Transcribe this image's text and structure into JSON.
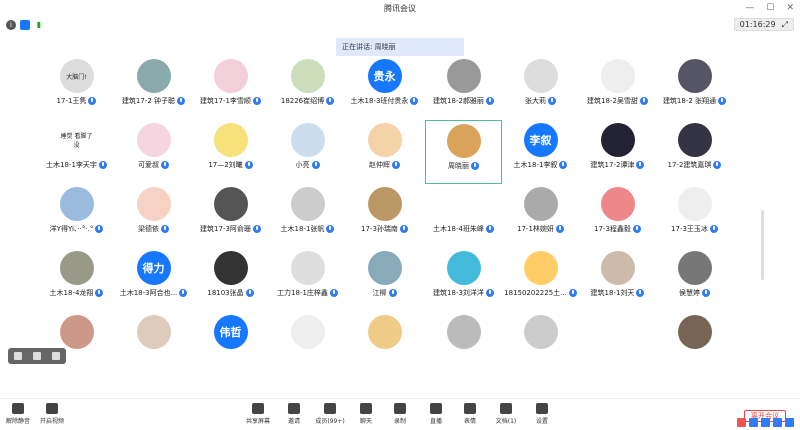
{
  "window": {
    "title": "腾讯会议",
    "timer": "01:16:29"
  },
  "speaking": "正在讲话: 周晓丽",
  "participants": [
    {
      "name": "17-1王隽",
      "avatar": "img",
      "color": "#ddd",
      "label": "大脑门!"
    },
    {
      "name": "建筑17-2 钟子聪",
      "avatar": "img",
      "color": "#8aa"
    },
    {
      "name": "建筑17-1李雪顺",
      "avatar": "img",
      "color": "#f3cfd9"
    },
    {
      "name": "18226崔绍博",
      "avatar": "img",
      "color": "#cdb"
    },
    {
      "name": "土木18-3班付贵永",
      "avatar": "text",
      "text": "贵永"
    },
    {
      "name": "建筑18-2郝雅丽",
      "avatar": "img",
      "color": "#999"
    },
    {
      "name": "张大莉",
      "avatar": "img",
      "color": "#ddd"
    },
    {
      "name": "建筑18-2吴雪甜",
      "avatar": "img",
      "color": "#eee"
    },
    {
      "name": "建筑18-2 张翔通",
      "avatar": "img",
      "color": "#556"
    },
    {
      "name": "土木18-1李天宇",
      "avatar": "img",
      "color": "#fff",
      "label": "睡觉 看脚了没"
    },
    {
      "name": "可爱叔",
      "avatar": "img",
      "color": "#f5d5e0"
    },
    {
      "name": "17—2刘曦",
      "avatar": "img",
      "color": "#f7e27a"
    },
    {
      "name": "小亮",
      "avatar": "img",
      "color": "#cde"
    },
    {
      "name": "赵仲辉",
      "avatar": "img",
      "color": "#f4d3a8"
    },
    {
      "name": "周晓丽",
      "avatar": "img",
      "color": "#d9a35b",
      "active": true
    },
    {
      "name": "土木18-1李叙",
      "avatar": "text",
      "text": "李叙"
    },
    {
      "name": "建筑17-2谭津",
      "avatar": "img",
      "color": "#223"
    },
    {
      "name": "17-2建筑嘉琪",
      "avatar": "img",
      "color": "#334"
    },
    {
      "name": "洋Y得Yi、··°·.°",
      "avatar": "img",
      "color": "#9bd"
    },
    {
      "name": "梁德依",
      "avatar": "img",
      "color": "#f6d2c4"
    },
    {
      "name": "建筑17-3阿俞珊",
      "avatar": "img",
      "color": "#555"
    },
    {
      "name": "土木18-1张帆",
      "avatar": "img",
      "color": "#ccc"
    },
    {
      "name": "17-3孙瑞南",
      "avatar": "img",
      "color": "#b96"
    },
    {
      "name": "土木18-4班朱峰",
      "avatar": "img",
      "color": "#fff"
    },
    {
      "name": "17-1林婉妍",
      "avatar": "img",
      "color": "#aaa"
    },
    {
      "name": "17-3程鑫毅",
      "avatar": "img",
      "color": "#e88"
    },
    {
      "name": "17-3王玉冰",
      "avatar": "img",
      "color": "#eee"
    },
    {
      "name": "土木18-4龙翔",
      "avatar": "img",
      "color": "#998"
    },
    {
      "name": "土木18-3阿合也...",
      "avatar": "text",
      "text": "得力"
    },
    {
      "name": "18103张晶",
      "avatar": "img",
      "color": "#333"
    },
    {
      "name": "工力18-1庄梓鑫",
      "avatar": "img",
      "color": "#ddd"
    },
    {
      "name": "江柳",
      "avatar": "img",
      "color": "#8ab"
    },
    {
      "name": "建筑18-3刘洋洋",
      "avatar": "img",
      "color": "#4bd"
    },
    {
      "name": "18150202225土...",
      "avatar": "img",
      "color": "#fc6"
    },
    {
      "name": "建筑18-1刘天",
      "avatar": "img",
      "color": "#cba"
    },
    {
      "name": "侯慧婷",
      "avatar": "img",
      "color": "#777"
    },
    {
      "name": "",
      "avatar": "img",
      "color": "#c98"
    },
    {
      "name": "",
      "avatar": "img",
      "color": "#dcb"
    },
    {
      "name": "",
      "avatar": "text",
      "text": "伟哲"
    },
    {
      "name": "",
      "avatar": "img",
      "color": "#eee"
    },
    {
      "name": "",
      "avatar": "img",
      "color": "#ec8"
    },
    {
      "name": "",
      "avatar": "img",
      "color": "#bbb"
    },
    {
      "name": "",
      "avatar": "img",
      "color": "#ccc"
    },
    {
      "name": "",
      "avatar": "img",
      "color": "#fff"
    },
    {
      "name": "",
      "avatar": "img",
      "color": "#765"
    }
  ],
  "toolbar": {
    "mute": "解除静音",
    "video": "开启视频",
    "share": "共享屏幕",
    "invite": "邀请",
    "members": "成员(99+)",
    "chat": "聊天",
    "record": "录制",
    "live": "直播",
    "apps": "表情",
    "docs": "文档(1)",
    "settings": "设置",
    "end": "离开会议"
  }
}
